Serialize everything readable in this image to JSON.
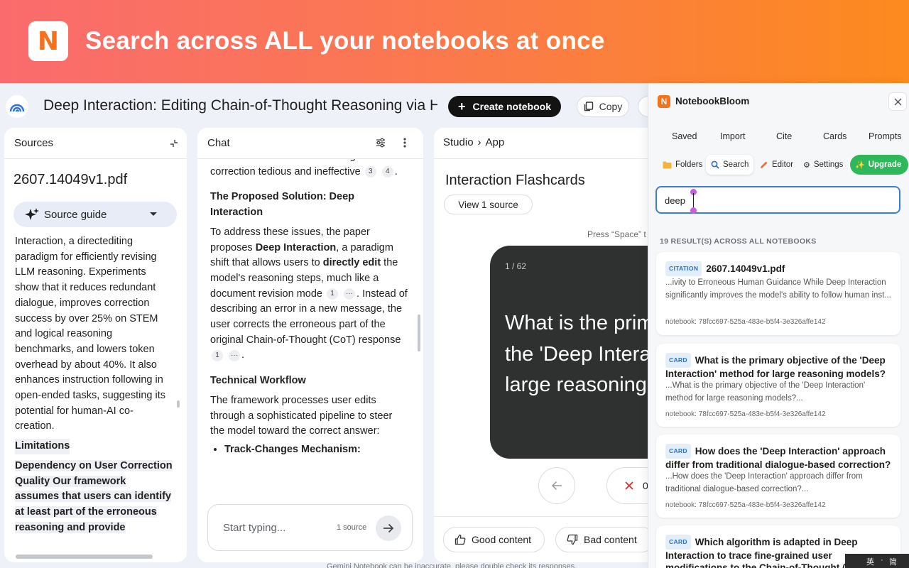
{
  "banner": {
    "logo_letter": "N",
    "headline": "Search across ALL your notebooks at once"
  },
  "appbar": {
    "notebook_title": "Deep Interaction: Editing Chain-of-Thought Reasoning via Hum",
    "create_label": "Create notebook",
    "copy_label": "Copy"
  },
  "sources": {
    "header": "Sources",
    "file_name": "2607.14049v1.pdf",
    "guide_label": "Source guide",
    "guide_text": "Interaction, a directediting paradigm for efficiently revising LLM reasoning. Experiments show that it reduces redundant dialogue, improves correction success by over 25% on STEM and logical reasoning benchmarks, and lowers token overhead by about 40%. It also enhances instruction following in open-ended tasks, suggesting its potential for human-AI co-creation.",
    "limitations_heading": "Limitations",
    "dependency_text": "Dependency on User Correction Quality Our framework assumes that users can identify at least part of the erroneous reasoning and provide"
  },
  "chat": {
    "header": "Chat",
    "para1_text": "data can make traditional dialogue based correction tedious and ineffective",
    "para1_cites": [
      "3",
      "4"
    ],
    "heading1": "The Proposed Solution: Deep Interaction",
    "para2_a": "To address these issues, the paper proposes ",
    "para2_b": "Deep Interaction",
    "para2_c": ", a paradigm shift that allows users to ",
    "para2_d": "directly edit",
    "para2_e": " the model's reasoning steps, much like a document revision mode",
    "para2_f": ". Instead of describing an error in a new message, the user corrects the erroneous part of the original Chain-of-Thought (CoT) response",
    "cite_1": "1",
    "cite_more": "···",
    "heading2": "Technical Workflow",
    "para3": "The framework processes user edits through a sophisticated pipeline to steer the model toward the correct answer:",
    "bullet1": "Track-Changes Mechanism:",
    "input_placeholder": "Start typing...",
    "source_count": "1 source"
  },
  "studio": {
    "crumb1": "Studio",
    "crumb2": "App",
    "title": "Interaction Flashcards",
    "view_source": "View 1 source",
    "press_hint": "Press “Space” t",
    "card_counter": "1 / 62",
    "card_question": "What is the prim the 'Deep Intera large reasoning",
    "card_line1": "What is the prim",
    "card_line2": "the 'Deep Intera",
    "card_line3": "large reasoning",
    "wrong_count": "0",
    "good_label": "Good content",
    "bad_label": "Bad content",
    "footer_note": "Gemini Notebook can be inaccurate, please double check its responses."
  },
  "drawer": {
    "brand": "NotebookBloom",
    "logo_letter": "N",
    "tabs": [
      "Saved",
      "Import",
      "Cite",
      "Cards",
      "Prompts"
    ],
    "tools": {
      "folders": "Folders",
      "search": "Search",
      "editor": "Editor",
      "settings": "Settings",
      "upgrade": "Upgrade"
    },
    "search_value": "deep",
    "results_count": "19 RESULT(S) ACROSS ALL NOTEBOOKS",
    "results": [
      {
        "tag": "CITATION",
        "title": "2607.14049v1.pdf",
        "snippet": "...ivity to Erroneous Human Guidance While Deep Interaction significantly improves the model's ability to follow human inst...",
        "notebook": "notebook: 78fcc697-525a-483e-b5f4-3e326affe142"
      },
      {
        "tag": "CARD",
        "title": "What is the primary objective of the 'Deep Interaction' method for large reasoning models?",
        "snippet": "...What is the primary objective of the 'Deep Interaction' method for large reasoning models?...",
        "notebook": "notebook: 78fcc697-525a-483e-b5f4-3e326affe142"
      },
      {
        "tag": "CARD",
        "title": "How does the 'Deep Interaction' approach differ from traditional dialogue-based correction?",
        "snippet": "...How does the 'Deep Interaction' approach differ from traditional dialogue-based correction?...",
        "notebook": "notebook: 78fcc697-525a-483e-b5f4-3e326affe142"
      },
      {
        "tag": "CARD",
        "title": "Which algorithm is adapted in Deep Interaction to trace fine-grained user modifications to the Chain-of-Thought (CoT)?",
        "snippet": "",
        "notebook": ""
      }
    ]
  },
  "tray": {
    "char1": "英",
    "char2": "·",
    "char3": "简"
  },
  "colors": {
    "banner_start": "#fa6b6e",
    "banner_end": "#fc8a1e",
    "accent_blue": "#3b7ddd",
    "upgrade_green": "#2fb85a",
    "card_dark": "#2f3030",
    "wrong_red": "#d93025"
  }
}
